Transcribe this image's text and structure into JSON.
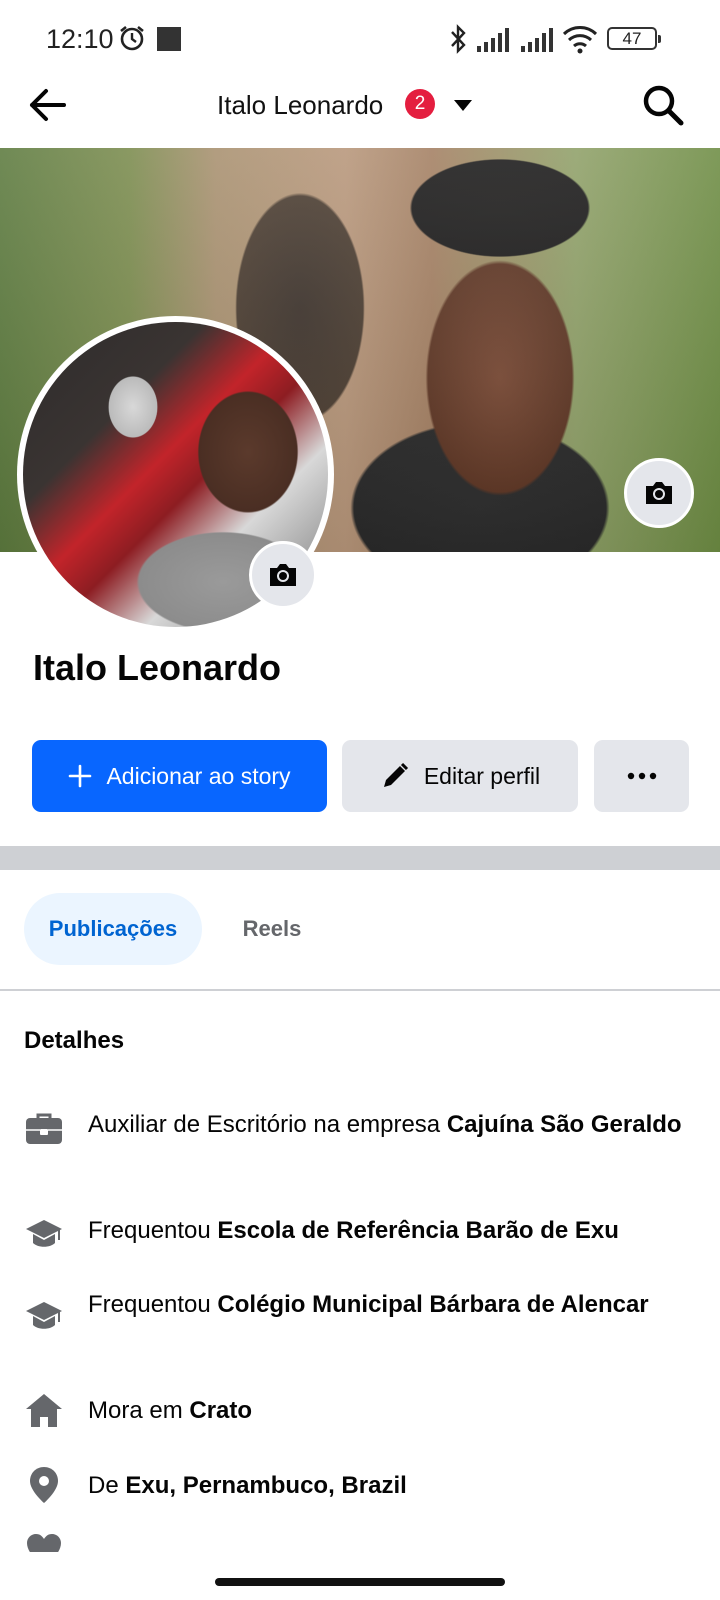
{
  "status_bar": {
    "time": "12:10",
    "battery": "47"
  },
  "header": {
    "title": "Italo Leonardo",
    "badge": "2"
  },
  "profile": {
    "name": "Italo Leonardo"
  },
  "actions": {
    "add_story": "Adicionar ao story",
    "edit_profile": "Editar perfil",
    "more": "•••"
  },
  "tabs": [
    {
      "label": "Publicações",
      "selected": true
    },
    {
      "label": "Reels",
      "selected": false
    }
  ],
  "details": {
    "title": "Detalhes",
    "items": [
      {
        "icon": "briefcase-icon",
        "prefix": "Auxiliar de Escritório na empresa ",
        "bold": "Cajuína São Geraldo"
      },
      {
        "icon": "graduation-cap-icon",
        "prefix": "Frequentou ",
        "bold": "Escola de Referência Barão de Exu"
      },
      {
        "icon": "graduation-cap-icon",
        "prefix": "Frequentou ",
        "bold": "Colégio Municipal Bárbara de Alencar"
      },
      {
        "icon": "home-icon",
        "prefix": "Mora em ",
        "bold": "Crato"
      },
      {
        "icon": "location-pin-icon",
        "prefix": "De ",
        "bold": "Exu, Pernambuco, Brazil"
      }
    ]
  },
  "colors": {
    "primary": "#0866ff",
    "badge": "#e41e3f",
    "tab_selected_bg": "#ebf5ff",
    "tab_selected_text": "#0064d1",
    "icon_gray": "#65676b"
  }
}
